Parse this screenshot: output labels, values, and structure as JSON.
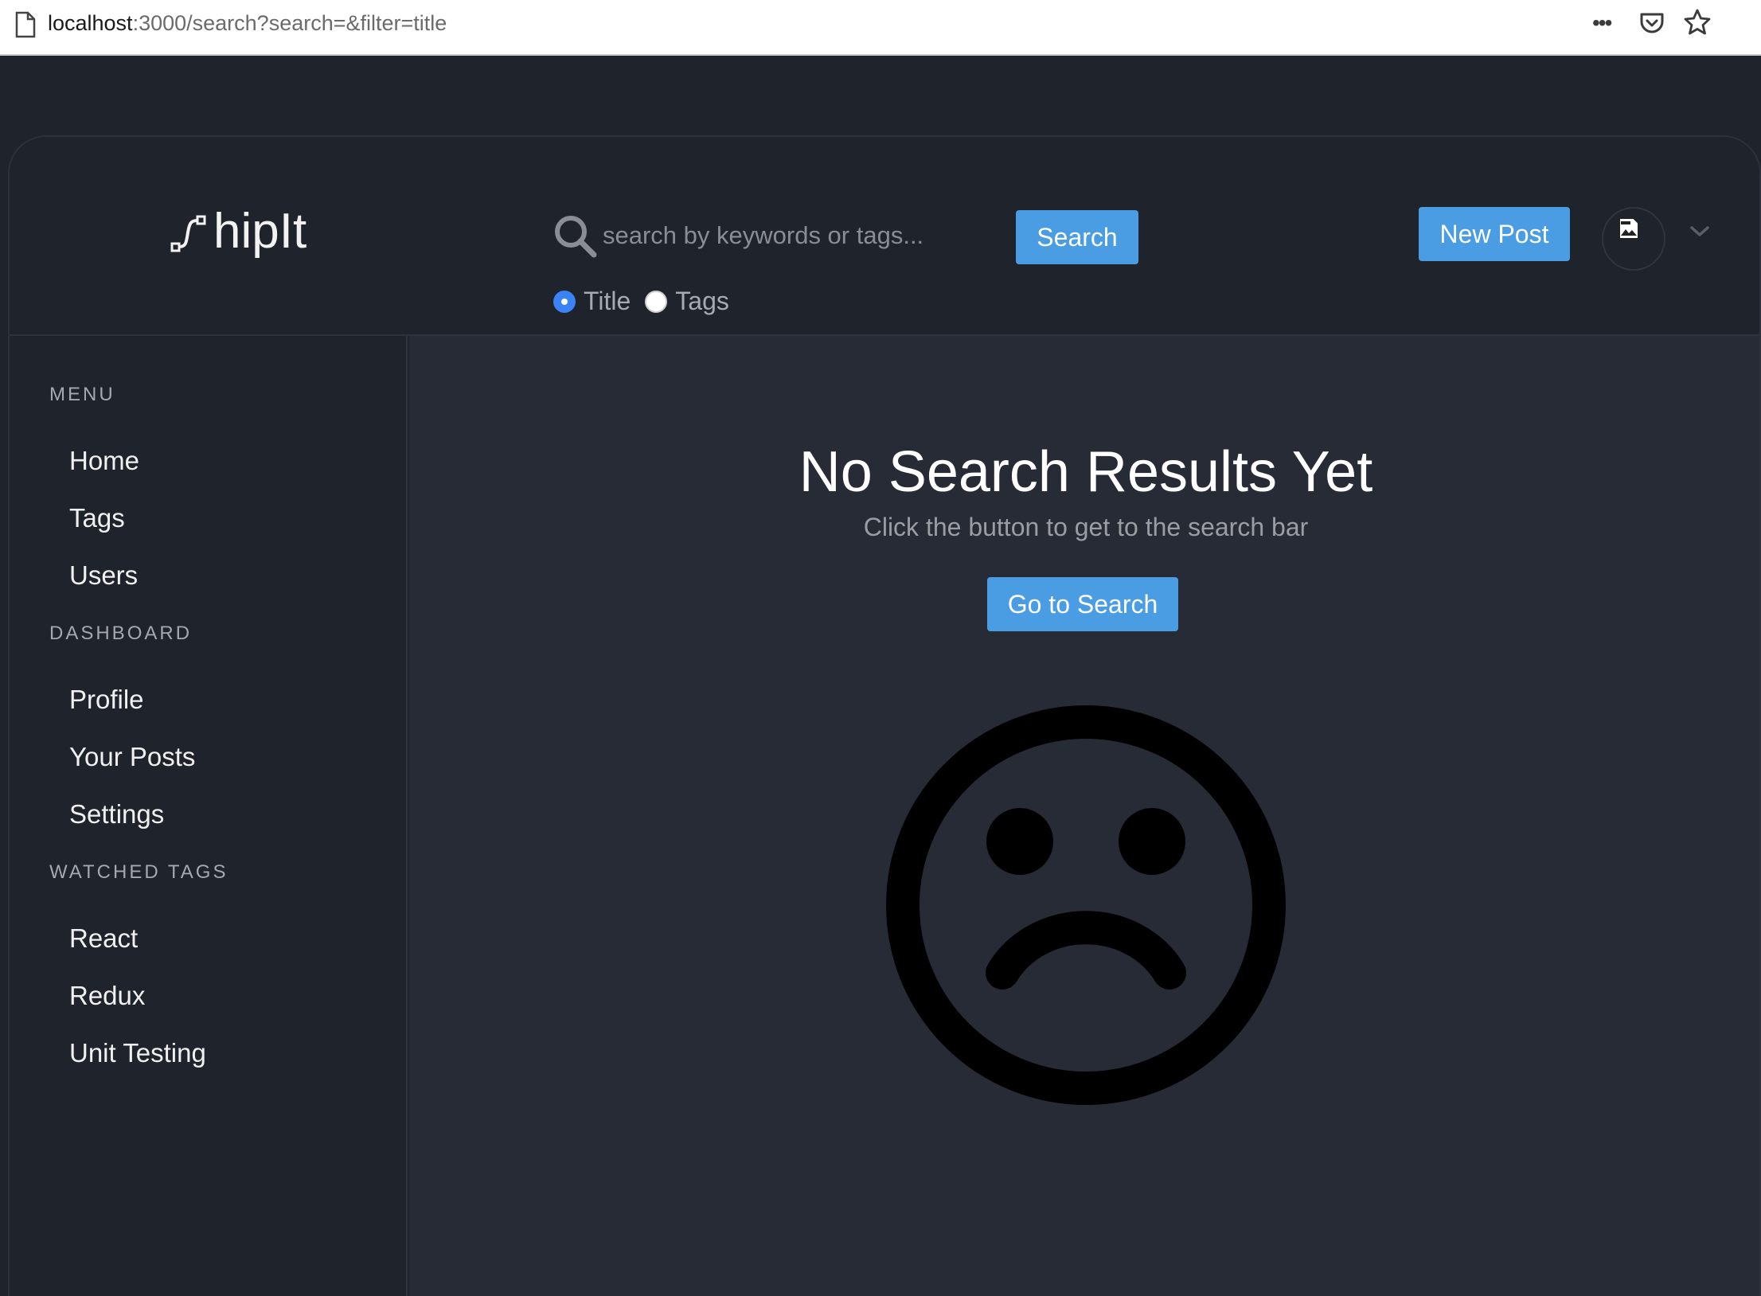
{
  "browser": {
    "url_host": "localhost",
    "url_rest": ":3000/search?search=&filter=title"
  },
  "header": {
    "logo_text": "hipIt",
    "search_placeholder": "search by keywords or tags...",
    "search_button": "Search",
    "filter_options": [
      {
        "label": "Title",
        "checked": true
      },
      {
        "label": "Tags",
        "checked": false
      }
    ],
    "new_post_button": "New Post"
  },
  "sidebar": {
    "sections": [
      {
        "title": "MENU",
        "items": [
          "Home",
          "Tags",
          "Users"
        ]
      },
      {
        "title": "DASHBOARD",
        "items": [
          "Profile",
          "Your Posts",
          "Settings"
        ]
      },
      {
        "title": "WATCHED TAGS",
        "items": [
          "React",
          "Redux",
          "Unit Testing"
        ]
      }
    ]
  },
  "main": {
    "title": "No Search Results Yet",
    "subtitle": "Click the button to get to the search bar",
    "go_button": "Go to Search"
  },
  "colors": {
    "accent": "#4a9de3",
    "background": "#1f232c",
    "main_background": "#272b35"
  }
}
